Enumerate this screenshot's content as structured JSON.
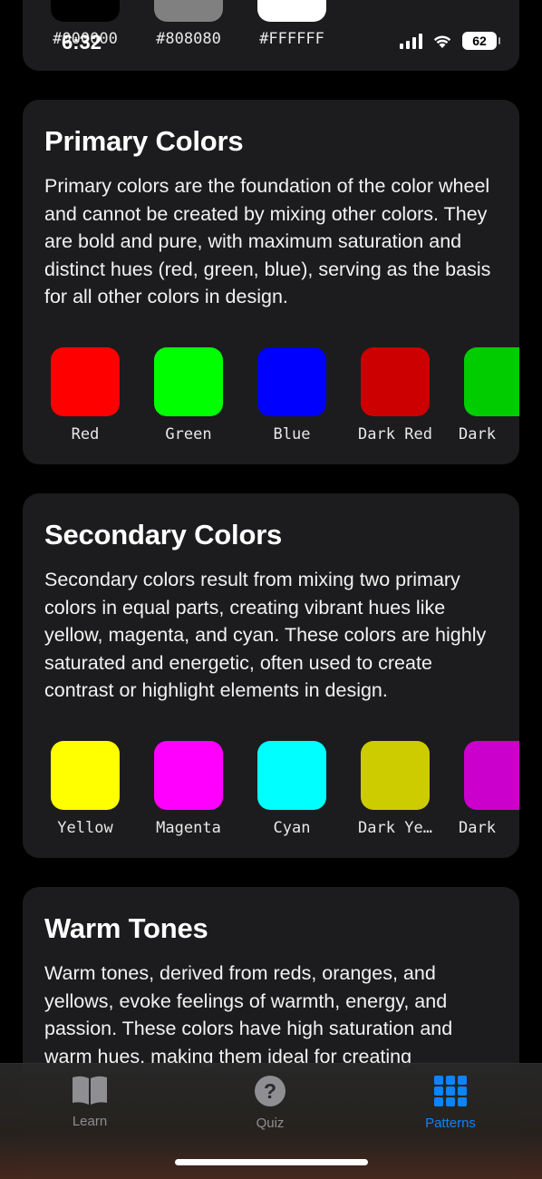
{
  "status_bar": {
    "time": "6:32",
    "battery": "62"
  },
  "neutral_swatches": [
    {
      "hex": "#000000",
      "color": "#000000"
    },
    {
      "hex": "#808080",
      "color": "#808080"
    },
    {
      "hex": "#FFFFFF",
      "color": "#FFFFFF"
    }
  ],
  "sections": [
    {
      "title": "Primary Colors",
      "description": "Primary colors are the foundation of the color wheel and cannot be created by mixing other colors. They are bold and pure, with maximum saturation and distinct hues (red, green, blue), serving as the basis for all other colors in design.",
      "swatches": [
        {
          "label": "Red",
          "color": "#FF0000"
        },
        {
          "label": "Green",
          "color": "#00FF00"
        },
        {
          "label": "Blue",
          "color": "#0000FF"
        },
        {
          "label": "Dark Red",
          "color": "#CC0000"
        },
        {
          "label": "Dark",
          "color": "#00CC00"
        }
      ]
    },
    {
      "title": "Secondary Colors",
      "description": "Secondary colors result from mixing two primary colors in equal parts, creating vibrant hues like yellow, magenta, and cyan. These colors are highly saturated and energetic, often used to create contrast or highlight elements in design.",
      "swatches": [
        {
          "label": "Yellow",
          "color": "#FFFF00"
        },
        {
          "label": "Magenta",
          "color": "#FF00FF"
        },
        {
          "label": "Cyan",
          "color": "#00FFFF"
        },
        {
          "label": "Dark Ye…",
          "color": "#CCCC00"
        },
        {
          "label": "Dark",
          "color": "#CC00CC"
        }
      ]
    },
    {
      "title": "Warm Tones",
      "description": "Warm tones, derived from reds, oranges, and yellows, evoke feelings of warmth, energy, and passion. These colors have high saturation and warm hues, making them ideal for creating"
    }
  ],
  "tabs": [
    {
      "label": "Learn",
      "icon": "book-icon",
      "active": false
    },
    {
      "label": "Quiz",
      "icon": "question-icon",
      "active": false
    },
    {
      "label": "Patterns",
      "icon": "grid-icon",
      "active": true
    }
  ],
  "colors": {
    "background": "#000000",
    "card": "#1c1c1e",
    "accent": "#0a84ff",
    "inactive_tab": "#8e8e93"
  }
}
